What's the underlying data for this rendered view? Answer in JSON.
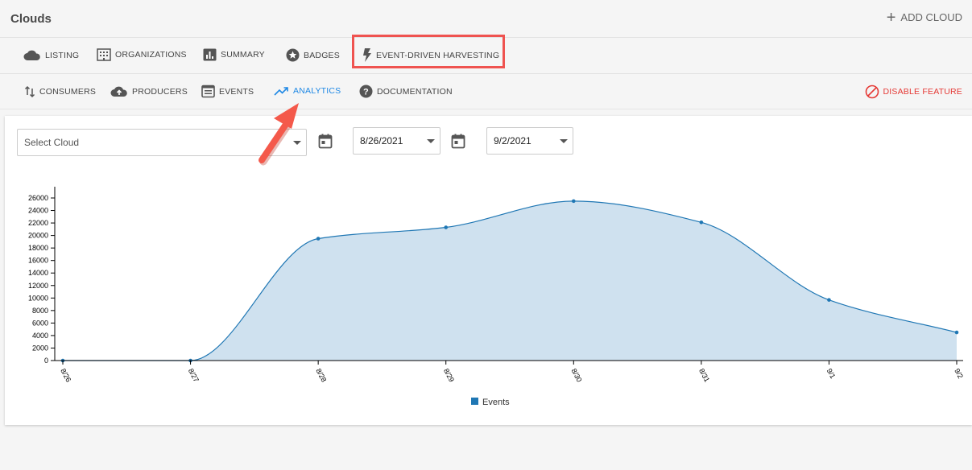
{
  "header": {
    "title": "Clouds",
    "add_cloud_label": "ADD CLOUD"
  },
  "nav_primary": {
    "items": [
      {
        "label": "LISTING",
        "icon": "cloud-icon"
      },
      {
        "label": "ORGANIZATIONS",
        "icon": "building-icon"
      },
      {
        "label": "SUMMARY",
        "icon": "bar-chart-icon"
      },
      {
        "label": "BADGES",
        "icon": "star-badge-icon"
      },
      {
        "label": "EVENT-DRIVEN HARVESTING",
        "icon": "lightning-icon",
        "highlighted": true
      }
    ]
  },
  "nav_secondary": {
    "items": [
      {
        "label": "CONSUMERS",
        "icon": "swap-vertical-icon"
      },
      {
        "label": "PRODUCERS",
        "icon": "cloud-upload-icon"
      },
      {
        "label": "EVENTS",
        "icon": "list-box-icon"
      },
      {
        "label": "ANALYTICS",
        "icon": "trending-up-icon",
        "active": true
      },
      {
        "label": "DOCUMENTATION",
        "icon": "help-circle-icon"
      }
    ],
    "disable_label": "DISABLE FEATURE"
  },
  "filters": {
    "cloud_placeholder": "Select Cloud",
    "start_date": "8/26/2021",
    "end_date": "9/2/2021"
  },
  "colors": {
    "accent": "#1e88e5",
    "danger": "#e53935",
    "series": "#1f77b4",
    "fill": "#cfe1ef",
    "highlight_box": "#ef5350",
    "arrow": "#f4594b"
  },
  "chart_data": {
    "type": "area",
    "categories": [
      "8/26",
      "8/27",
      "8/28",
      "8/29",
      "8/30",
      "8/31",
      "9/1",
      "9/2"
    ],
    "series": [
      {
        "name": "Events",
        "values": [
          0,
          0,
          19500,
          21300,
          25500,
          22100,
          9700,
          4500
        ]
      }
    ],
    "yticks": [
      0,
      2000,
      4000,
      6000,
      8000,
      10000,
      12000,
      14000,
      16000,
      18000,
      20000,
      22000,
      24000,
      26000
    ],
    "ylim": [
      0,
      26000
    ],
    "legend": "bottom-center"
  }
}
